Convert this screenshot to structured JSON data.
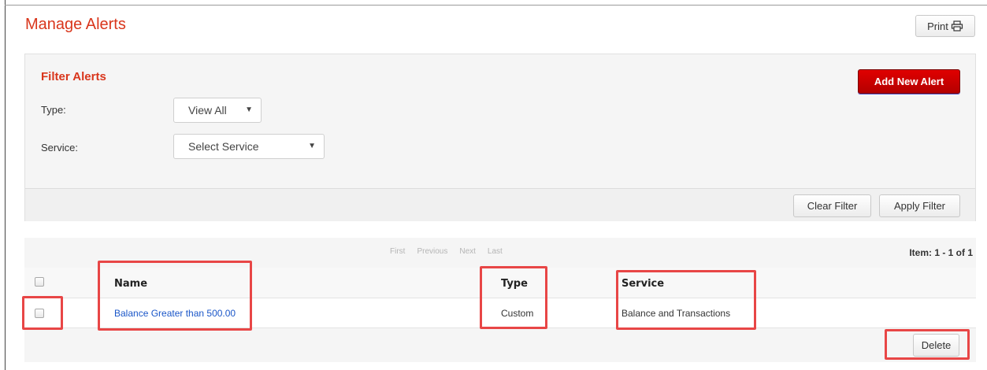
{
  "page": {
    "title": "Manage Alerts",
    "print_label": "Print"
  },
  "filter": {
    "title": "Filter Alerts",
    "add_button": "Add New Alert",
    "type_label": "Type:",
    "type_value": "View All",
    "service_label": "Service:",
    "service_value": "Select Service",
    "clear_button": "Clear Filter",
    "apply_button": "Apply Filter"
  },
  "table": {
    "pager": {
      "first": "First",
      "previous": "Previous",
      "next": "Next",
      "last": "Last"
    },
    "item_count": "Item: 1 - 1 of 1",
    "columns": {
      "name": "Name",
      "type": "Type",
      "service": "Service"
    },
    "rows": [
      {
        "name": "Balance Greater than 500.00",
        "type": "Custom",
        "service": "Balance and Transactions"
      }
    ],
    "delete_button": "Delete"
  },
  "colors": {
    "title_red": "#d9361c",
    "add_button_red": "#c80000",
    "link_blue": "#1a56c8",
    "highlight_red": "#e84646"
  },
  "icons": {
    "print": "printer-icon",
    "dropdown": "caret-down-icon"
  }
}
